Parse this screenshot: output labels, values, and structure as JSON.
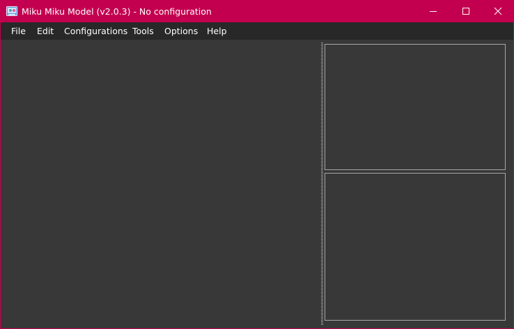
{
  "window": {
    "title": "Miku Miku Model (v2.0.3) - No configuration",
    "icon": "app-icon",
    "accent_color": "#c3004f",
    "controls": {
      "minimize_icon": "minimize-icon",
      "maximize_icon": "maximize-icon",
      "close_icon": "close-icon"
    }
  },
  "menubar": {
    "items": [
      {
        "label": "File"
      },
      {
        "label": "Edit"
      },
      {
        "label": "Configurations"
      },
      {
        "label": "Tools"
      },
      {
        "label": "Options"
      },
      {
        "label": "Help"
      }
    ]
  },
  "colors": {
    "background": "#383838",
    "menubar": "#282828",
    "panel_border": "#a8a8a8"
  }
}
